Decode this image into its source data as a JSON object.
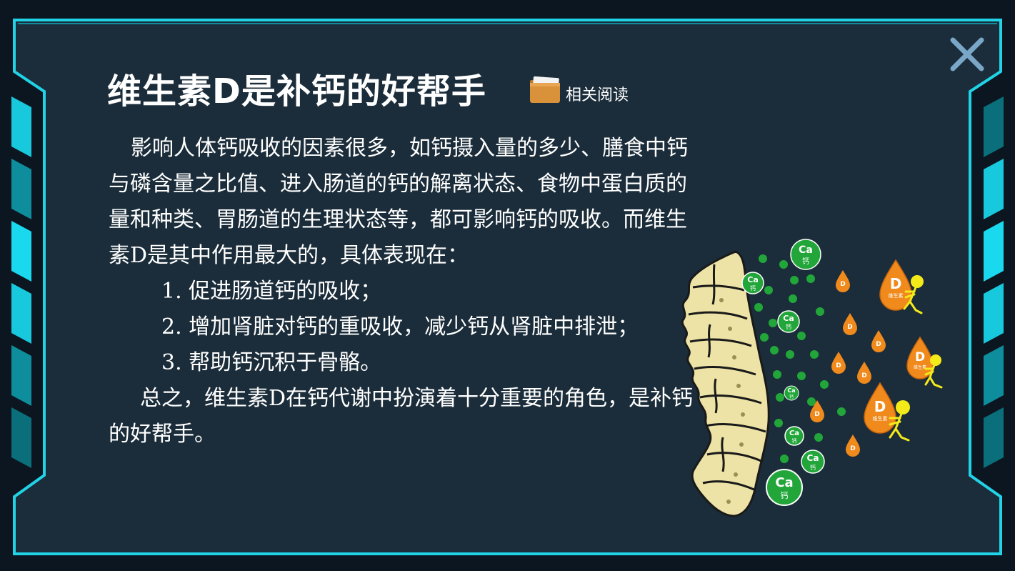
{
  "title": "维生素D是补钙的好帮手",
  "related_reading": {
    "label": "相关阅读",
    "icon": "folder-icon"
  },
  "close_icon": "close-icon",
  "paragraphs": {
    "intro": "影响人体钙吸收的因素很多，如钙摄入量的多少、膳食中钙与磷含量之比值、进入肠道的钙的解离状态、食物中蛋白质的量和种类、胃肠道的生理状态等，都可影响钙的吸收。而维生素D是其中作用最大的，具体表现在：",
    "items": [
      "1. 促进肠道钙的吸收；",
      "2. 增加肾脏对钙的重吸收，减少钙从肾脏中排泄；",
      "3. 帮助钙沉积于骨骼。"
    ],
    "conclusion": "总之，维生素D在钙代谢中扮演着十分重要的角色，是补钙的好帮手。"
  },
  "illustration": {
    "calcium_label": "Ca",
    "calcium_sub": "钙",
    "vitd_label": "D",
    "vitd_sub": "维生素"
  },
  "colors": {
    "frame_cyan": "#21d3e6",
    "panel_bg": "#1b2d3a",
    "calcium_green": "#22a63a",
    "vitd_orange": "#f08a1c",
    "figure_yellow": "#f4ea1a",
    "bone": "#ede3a6"
  }
}
